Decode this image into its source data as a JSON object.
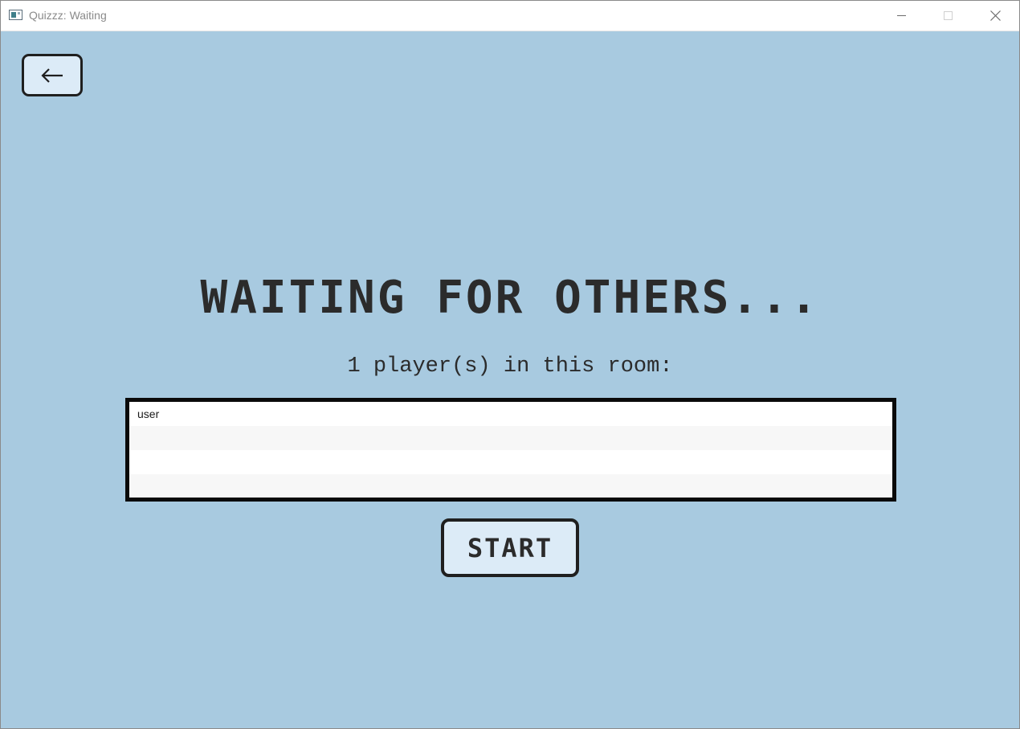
{
  "window": {
    "title": "Quizzz: Waiting"
  },
  "back_button": {
    "icon": "arrow-left-icon"
  },
  "heading": "WAITING FOR OTHERS...",
  "subheading": "1 player(s) in this room:",
  "players": [
    {
      "name": "user"
    },
    {
      "name": ""
    },
    {
      "name": ""
    },
    {
      "name": ""
    }
  ],
  "start_button": {
    "label": "START"
  },
  "colors": {
    "background": "#a8cae0",
    "button_fill": "#dcebf7",
    "text": "#2b2b2b"
  }
}
